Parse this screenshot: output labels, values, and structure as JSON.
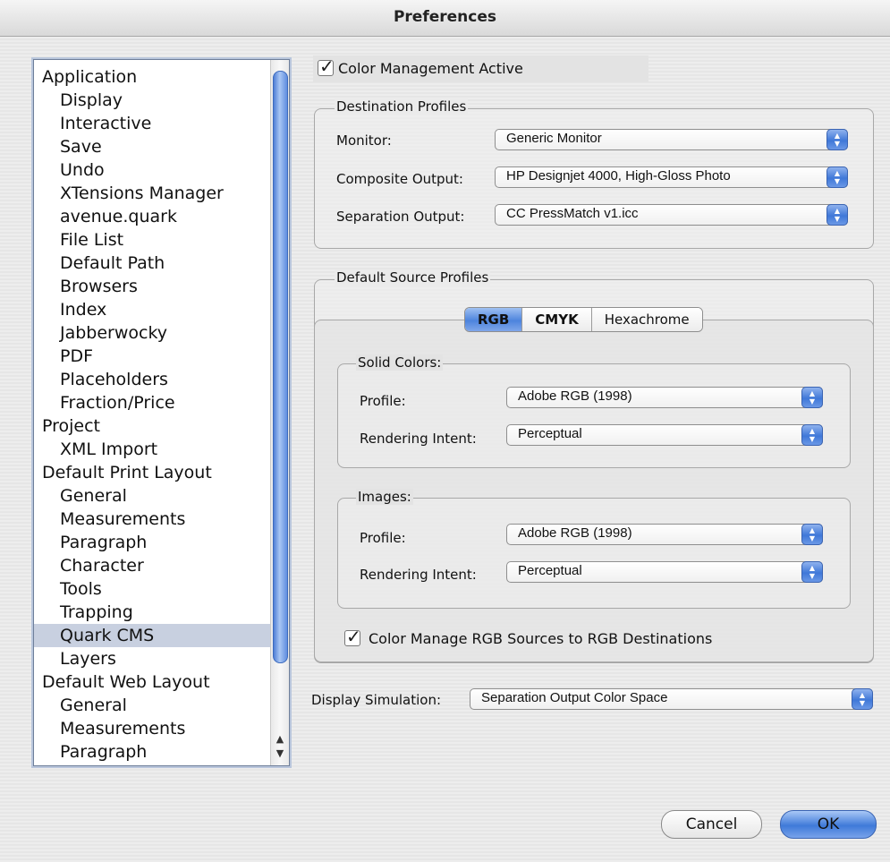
{
  "window": {
    "title": "Preferences"
  },
  "sidebar": {
    "items": [
      {
        "label": "Application",
        "level": 0
      },
      {
        "label": "Display",
        "level": 1
      },
      {
        "label": "Interactive",
        "level": 1
      },
      {
        "label": "Save",
        "level": 1
      },
      {
        "label": "Undo",
        "level": 1
      },
      {
        "label": "XTensions Manager",
        "level": 1
      },
      {
        "label": "avenue.quark",
        "level": 1
      },
      {
        "label": "File List",
        "level": 1
      },
      {
        "label": "Default Path",
        "level": 1
      },
      {
        "label": "Browsers",
        "level": 1
      },
      {
        "label": "Index",
        "level": 1
      },
      {
        "label": "Jabberwocky",
        "level": 1
      },
      {
        "label": "PDF",
        "level": 1
      },
      {
        "label": "Placeholders",
        "level": 1
      },
      {
        "label": "Fraction/Price",
        "level": 1
      },
      {
        "label": "Project",
        "level": 0
      },
      {
        "label": "XML Import",
        "level": 1
      },
      {
        "label": "Default Print Layout",
        "level": 0
      },
      {
        "label": "General",
        "level": 1
      },
      {
        "label": "Measurements",
        "level": 1
      },
      {
        "label": "Paragraph",
        "level": 1
      },
      {
        "label": "Character",
        "level": 1
      },
      {
        "label": "Tools",
        "level": 1
      },
      {
        "label": "Trapping",
        "level": 1
      },
      {
        "label": "Quark CMS",
        "level": 1,
        "selected": true
      },
      {
        "label": "Layers",
        "level": 1
      },
      {
        "label": "Default Web Layout",
        "level": 0
      },
      {
        "label": "General",
        "level": 1
      },
      {
        "label": "Measurements",
        "level": 1
      },
      {
        "label": "Paragraph",
        "level": 1
      }
    ]
  },
  "color_management": {
    "label": "Color Management Active",
    "checked": true
  },
  "destination_profiles": {
    "title": "Destination Profiles",
    "monitor_label": "Monitor:",
    "monitor_value": "Generic Monitor",
    "composite_label": "Composite Output:",
    "composite_value": "HP Designjet 4000, High-Gloss Photo",
    "separation_label": "Separation Output:",
    "separation_value": "CC PressMatch v1.icc"
  },
  "source_profiles": {
    "title": "Default Source Profiles",
    "tabs": [
      "RGB",
      "CMYK",
      "Hexachrome"
    ],
    "selected_tab": "RGB",
    "solid": {
      "title": "Solid Colors:",
      "profile_label": "Profile:",
      "profile_value": "Adobe RGB (1998)",
      "intent_label": "Rendering Intent:",
      "intent_value": "Perceptual"
    },
    "images": {
      "title": "Images:",
      "profile_label": "Profile:",
      "profile_value": "Adobe RGB (1998)",
      "intent_label": "Rendering Intent:",
      "intent_value": "Perceptual"
    },
    "rgb_to_rgb": {
      "label": "Color Manage RGB Sources to RGB Destinations",
      "checked": true
    }
  },
  "display_simulation": {
    "label": "Display Simulation:",
    "value": "Separation Output Color Space"
  },
  "buttons": {
    "cancel": "Cancel",
    "ok": "OK"
  },
  "colors": {
    "accent": "#4d84dd",
    "selection": "#c8d0e0"
  }
}
